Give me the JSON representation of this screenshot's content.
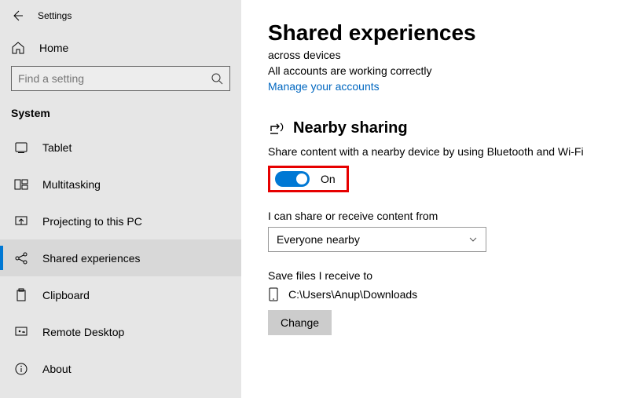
{
  "app_title": "Settings",
  "home_label": "Home",
  "search_placeholder": "Find a setting",
  "section_label": "System",
  "nav": [
    {
      "label": "Tablet"
    },
    {
      "label": "Multitasking"
    },
    {
      "label": "Projecting to this PC"
    },
    {
      "label": "Shared experiences"
    },
    {
      "label": "Clipboard"
    },
    {
      "label": "Remote Desktop"
    },
    {
      "label": "About"
    }
  ],
  "page": {
    "title": "Shared experiences",
    "accounts": {
      "remnant": "across devices",
      "status": "All accounts are working correctly",
      "manage_link": "Manage your accounts"
    },
    "nearby": {
      "heading": "Nearby sharing",
      "desc": "Share content with a nearby device by using Bluetooth and Wi-Fi",
      "toggle_label": "On",
      "share_from_label": "I can share or receive content from",
      "share_from_value": "Everyone nearby",
      "save_label": "Save files I receive to",
      "save_path": "C:\\Users\\Anup\\Downloads",
      "change_btn": "Change"
    }
  }
}
